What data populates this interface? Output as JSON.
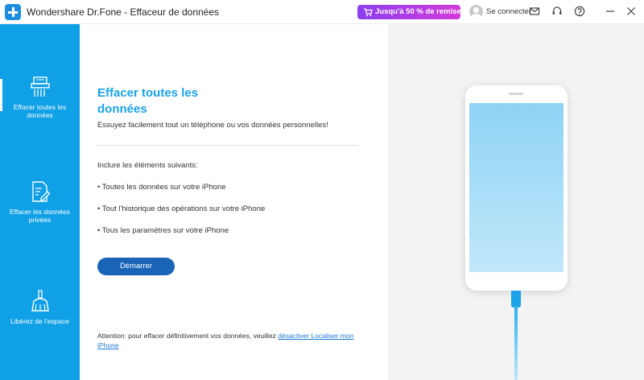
{
  "window": {
    "title": "Wondershare Dr.Fone - Effaceur de données",
    "promo": "Jusqu'à 50 % de remise",
    "login_label": "Se connecter",
    "icons": [
      "mail-icon",
      "headset-icon",
      "help-icon",
      "minimize-icon",
      "close-icon"
    ]
  },
  "sidebar": {
    "accent": "#0fa0e6",
    "items": [
      {
        "label": "Effacer toutes les données",
        "icon": "shredder-icon",
        "active": true
      },
      {
        "label": "Effacer les données privées",
        "icon": "document-edit-icon",
        "active": false
      },
      {
        "label": "Libérez de l'espace",
        "icon": "broom-icon",
        "active": false
      }
    ]
  },
  "main": {
    "title": "Effacer toutes les données",
    "subtitle": "Essuyez facilement tout un téléphone ou vos données personnelles!",
    "include_label": "Inclure les éléments suivants:",
    "bullets": [
      "• Toutes les données sur votre iPhone",
      "• Tout l'historique des opérations sur votre iPhone",
      "• Tous les paramètres sur votre iPhone"
    ],
    "start_button": "Démarrer",
    "warning_text": "Attention: pour effacer définitivement vos données, veuillez ",
    "warning_link": "désactiver Localiser mon iPhone"
  },
  "colors": {
    "title_blue": "#1aa3e8",
    "button_blue": "#1a64b8",
    "promo_gradient": [
      "#8b3ff0",
      "#d33ad9"
    ]
  }
}
